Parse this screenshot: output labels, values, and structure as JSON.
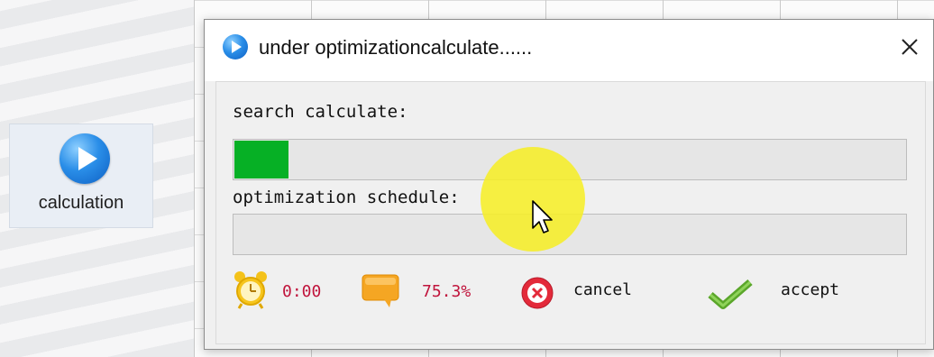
{
  "desktop": {
    "icon_label": "calculation",
    "icon_name": "play-circle-icon"
  },
  "dialog": {
    "title": "under optimizationcalculate......",
    "search_label": "search calculate:",
    "search_progress": 0.08,
    "schedule_label": "optimization schedule:",
    "schedule_progress": 0,
    "time_value": "0:00",
    "percent_value": "75.3%",
    "cancel_label": "cancel",
    "accept_label": "accept"
  },
  "colors": {
    "progress_fill": "#06b025",
    "value_text": "#c0143c",
    "cursor_highlight": "#f6ee28"
  }
}
